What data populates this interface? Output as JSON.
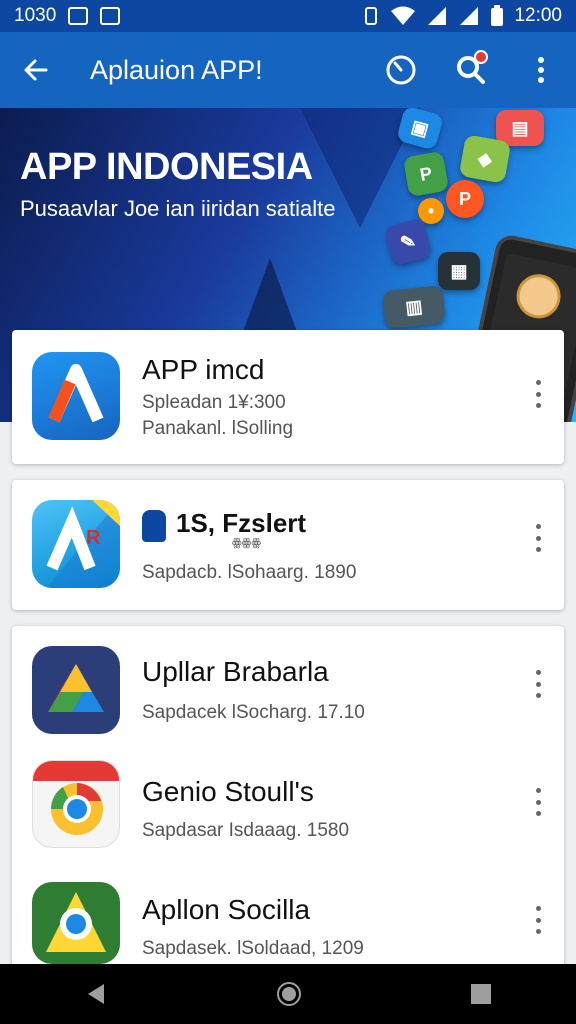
{
  "status_bar": {
    "time_left": "1030",
    "time_right": "12:00"
  },
  "app_bar": {
    "title": "Aplauion APP!"
  },
  "banner": {
    "title": "APP INDONESIA",
    "subtitle": "Pusaavlar Joe ian iiridan satialte"
  },
  "apps": [
    {
      "name": "APP imcd",
      "meta1": "Spleadan 1¥:300",
      "meta2": "Panakanl.   lSolling"
    },
    {
      "name": "1S, Fzslert",
      "tag": "ꙮꙮꙮ",
      "meta": "Sapdacb.   lSohaarg.  1890"
    },
    {
      "name": "Upllar Brabarla",
      "meta": "Sapdacek   lSocharg.  17.10"
    },
    {
      "name": "Genio Stoull's",
      "meta": "Sapdasar   Isdaaag.  1580"
    },
    {
      "name": "Apllon Socilla",
      "meta": "Sapdasek.   lSoldaad,  1209"
    }
  ],
  "colors": {
    "status_bar": "#0d47a1",
    "app_bar": "#1565c0",
    "accent_red": "#e53935"
  },
  "icons": [
    "back-arrow-icon",
    "clock-icon",
    "search-icon",
    "more-vert-icon",
    "back-nav-icon",
    "home-nav-icon",
    "recents-nav-icon"
  ]
}
